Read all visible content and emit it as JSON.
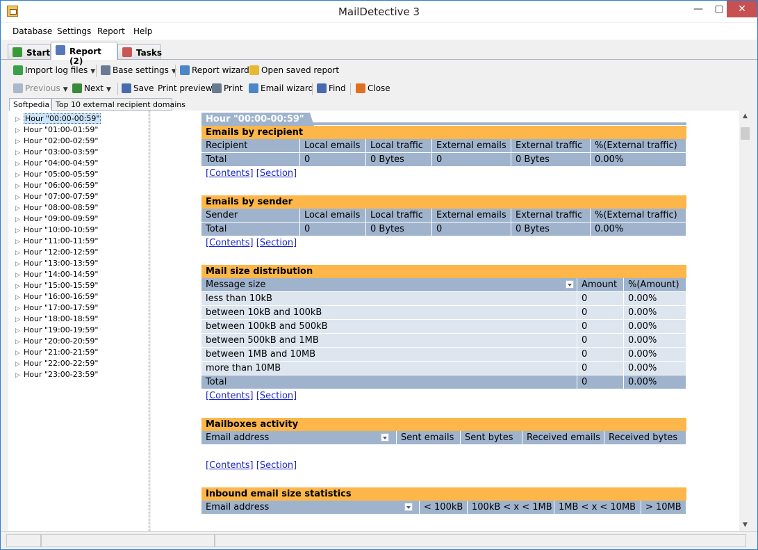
{
  "window": {
    "title": "MailDetective 3",
    "controls": {
      "minimize": "—",
      "maximize": "▢",
      "close": "✕"
    }
  },
  "menu": [
    "Database",
    "Settings",
    "Report",
    "Help"
  ],
  "tabs": [
    {
      "label": "Start",
      "icon": "start-icon",
      "color": "#3a9a3a"
    },
    {
      "label": "Report (2)",
      "icon": "report-icon",
      "color": "#5577bb"
    },
    {
      "label": "Tasks",
      "icon": "tasks-icon",
      "color": "#cc5555"
    }
  ],
  "toolbar1": [
    {
      "label": "Import log files",
      "icon": "import-icon",
      "color": "#3aa04a"
    },
    {
      "label": "Base settings",
      "icon": "wrench-icon",
      "color": "#6a7a90"
    },
    {
      "label": "Report wizard",
      "icon": "wand-icon",
      "color": "#4b86c8"
    },
    {
      "label": "Open saved report",
      "icon": "folder-icon",
      "color": "#e8b830"
    }
  ],
  "toolbar2": [
    {
      "label": "Previous",
      "icon": "back-arrow-icon",
      "color": "#aab8cc"
    },
    {
      "label": "Next",
      "icon": "forward-arrow-icon",
      "color": "#3a8a3a"
    },
    {
      "label": "Save",
      "icon": "save-icon",
      "color": "#4a6ab0"
    },
    {
      "label": "Print preview",
      "icon": "",
      "color": ""
    },
    {
      "label": "Print",
      "icon": "printer-icon",
      "color": "#6a7a90"
    },
    {
      "label": "Email wizard",
      "icon": "email-icon",
      "color": "#4b86c8"
    },
    {
      "label": "Find",
      "icon": "find-icon",
      "color": "#4a6ab0"
    },
    {
      "label": "Close",
      "icon": "close-x-icon",
      "color": "#e07020"
    }
  ],
  "side_tabs": [
    "Softpedia",
    "Top 10 external recipient domains"
  ],
  "tree_nodes": [
    "Hour \"00:00-00:59\"",
    "Hour \"01:00-01:59\"",
    "Hour \"02:00-02:59\"",
    "Hour \"03:00-03:59\"",
    "Hour \"04:00-04:59\"",
    "Hour \"05:00-05:59\"",
    "Hour \"06:00-06:59\"",
    "Hour \"07:00-07:59\"",
    "Hour \"08:00-08:59\"",
    "Hour \"09:00-09:59\"",
    "Hour \"10:00-10:59\"",
    "Hour \"11:00-11:59\"",
    "Hour \"12:00-12:59\"",
    "Hour \"13:00-13:59\"",
    "Hour \"14:00-14:59\"",
    "Hour \"15:00-15:59\"",
    "Hour \"16:00-16:59\"",
    "Hour \"17:00-17:59\"",
    "Hour \"18:00-18:59\"",
    "Hour \"19:00-19:59\"",
    "Hour \"20:00-20:59\"",
    "Hour \"21:00-21:59\"",
    "Hour \"22:00-22:59\"",
    "Hour \"23:00-23:59\""
  ],
  "report": {
    "heading": "Hour \"00:00-00:59\"",
    "links": {
      "contents": "[Contents]",
      "section": "[Section]"
    },
    "sections": [
      {
        "title": "Emails by recipient",
        "headers": [
          "Recipient",
          "Local emails",
          "Local traffic",
          "External emails",
          "External traffic",
          "%(External traffic)"
        ],
        "rows": [],
        "total": [
          "Total",
          "0",
          "0 Bytes",
          "0",
          "0 Bytes",
          "0.00%"
        ]
      },
      {
        "title": "Emails by sender",
        "headers": [
          "Sender",
          "Local emails",
          "Local traffic",
          "External emails",
          "External traffic",
          "%(External traffic)"
        ],
        "rows": [],
        "total": [
          "Total",
          "0",
          "0 Bytes",
          "0",
          "0 Bytes",
          "0.00%"
        ]
      },
      {
        "title": "Mail size distribution",
        "headers": [
          "Message size",
          "Amount",
          "%(Amount)"
        ],
        "rows": [
          [
            "less than 10kB",
            "0",
            "0.00%"
          ],
          [
            "between 10kB and 100kB",
            "0",
            "0.00%"
          ],
          [
            "between 100kB and 500kB",
            "0",
            "0.00%"
          ],
          [
            "between 500kB and 1MB",
            "0",
            "0.00%"
          ],
          [
            "between 1MB and 10MB",
            "0",
            "0.00%"
          ],
          [
            "more than 10MB",
            "0",
            "0.00%"
          ]
        ],
        "total": [
          "Total",
          "0",
          "0.00%"
        ]
      },
      {
        "title": "Mailboxes activity",
        "headers": [
          "Email address",
          "Sent emails",
          "Sent bytes",
          "Received emails",
          "Received bytes"
        ],
        "rows": [],
        "total": null
      },
      {
        "title": "Inbound email size statistics",
        "headers": [
          "Email address",
          "< 100kB",
          "100kB < x < 1MB",
          "1MB < x < 10MB",
          "> 10MB"
        ],
        "rows": [],
        "total": null
      }
    ]
  }
}
